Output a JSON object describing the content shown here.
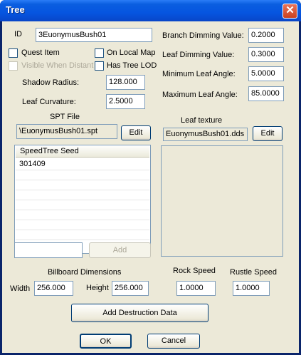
{
  "window": {
    "title": "Tree",
    "close_glyph": "✕"
  },
  "id_field": {
    "label": "ID",
    "value": "3EuonymusBush01"
  },
  "checkboxes": {
    "quest_item": "Quest Item",
    "on_local_map": "On Local Map",
    "visible_when_distant": "Visible When Distant",
    "has_tree_lod": "Has Tree LOD"
  },
  "shadow_radius": {
    "label": "Shadow Radius:",
    "value": "128.000"
  },
  "leaf_curvature": {
    "label": "Leaf Curvature:",
    "value": "2.5000"
  },
  "branch_dimming": {
    "label": "Branch Dimming Value:",
    "value": "0.2000"
  },
  "leaf_dimming": {
    "label": "Leaf Dimming Value:",
    "value": "0.3000"
  },
  "min_leaf_angle": {
    "label": "Minimum Leaf Angle:",
    "value": "5.0000"
  },
  "max_leaf_angle": {
    "label": "Maximum Leaf Angle:",
    "value": "85.0000"
  },
  "spt_file": {
    "label": "SPT File",
    "value": "\\EuonymusBush01.spt",
    "edit_label": "Edit"
  },
  "leaf_texture": {
    "label": "Leaf texture",
    "value": "EuonymusBush01.dds",
    "edit_label": "Edit"
  },
  "speedtree_seed": {
    "header": "SpeedTree Seed",
    "rows": [
      "301409"
    ]
  },
  "add_seed": {
    "value": "",
    "button_label": "Add"
  },
  "billboard": {
    "label": "Billboard Dimensions",
    "width_label": "Width",
    "width_value": "256.000",
    "height_label": "Height",
    "height_value": "256.000"
  },
  "rock_speed": {
    "label": "Rock Speed",
    "value": "1.0000"
  },
  "rustle_speed": {
    "label": "Rustle Speed",
    "value": "1.0000"
  },
  "buttons": {
    "add_destruction": "Add Destruction Data",
    "ok": "OK",
    "cancel": "Cancel"
  }
}
